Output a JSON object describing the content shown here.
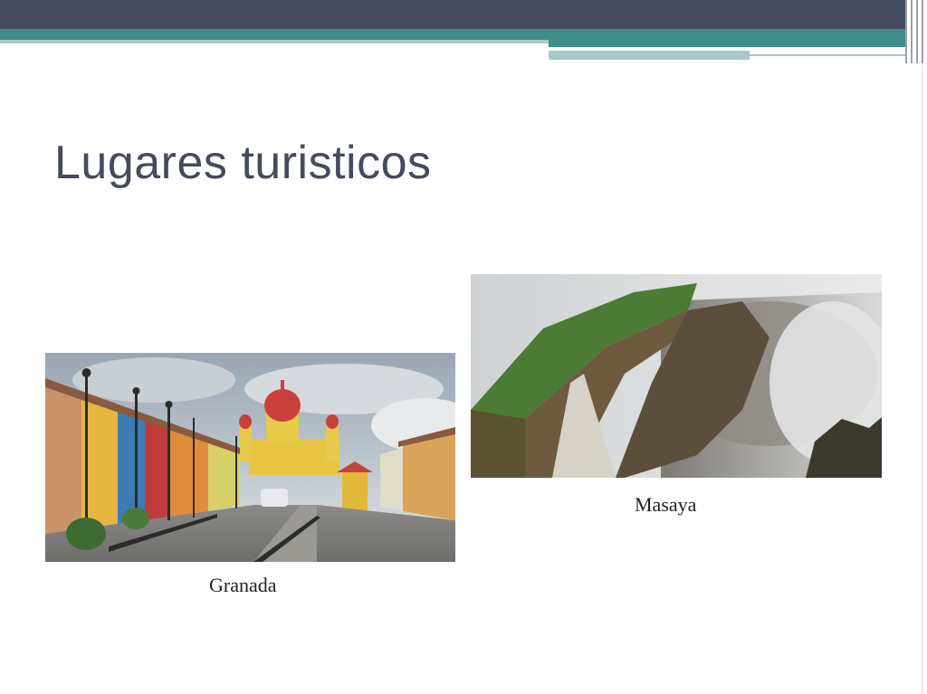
{
  "slide": {
    "title": "Lugares turisticos",
    "images": [
      {
        "caption": "Granada",
        "icon": "granada-photo"
      },
      {
        "caption": "Masaya",
        "icon": "masaya-volcano-photo"
      }
    ]
  },
  "colors": {
    "header_dark": "#454a5c",
    "header_teal": "#3f8e8a",
    "header_teal_light": "#a7c9c7",
    "title_text": "#454a5c"
  }
}
